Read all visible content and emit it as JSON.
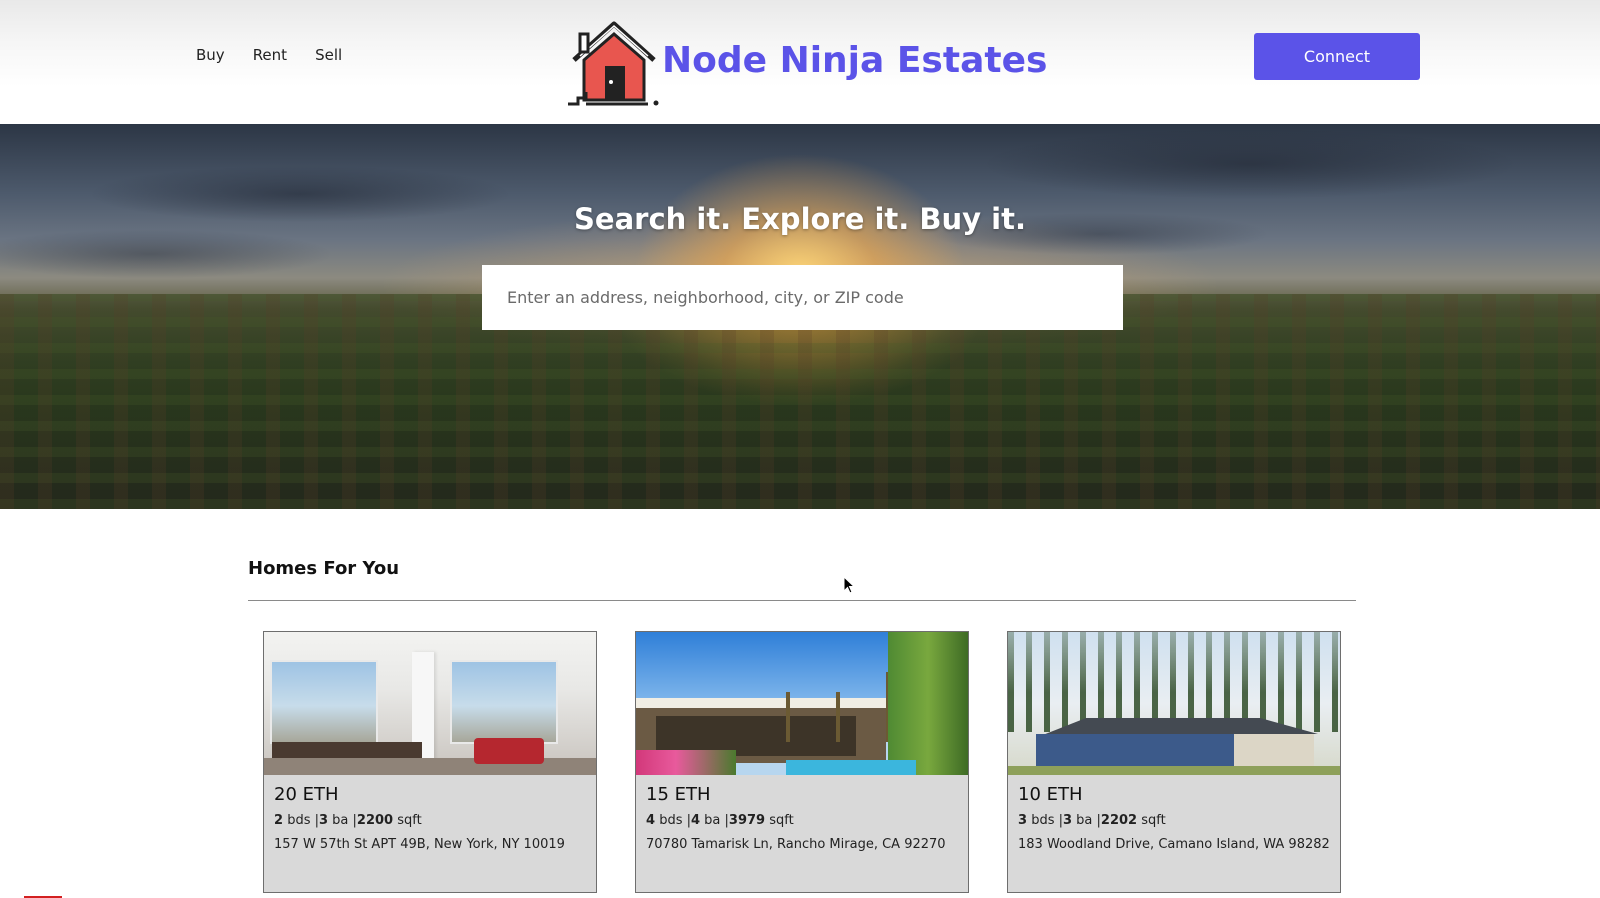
{
  "nav": {
    "buy": "Buy",
    "rent": "Rent",
    "sell": "Sell"
  },
  "brand": {
    "title": "Node Ninja Estates",
    "logo_icon": "house-icon",
    "accent": "#5b53e8"
  },
  "header": {
    "connect_label": "Connect"
  },
  "hero": {
    "tagline": "Search it. Explore it. Buy it.",
    "search_placeholder": "Enter an address, neighborhood, city, or ZIP code"
  },
  "section": {
    "title": "Homes For You"
  },
  "listings": [
    {
      "price": "20 ETH",
      "beds": "2",
      "beds_unit": "bds",
      "baths": "3",
      "baths_unit": "ba",
      "sqft": "2200",
      "sqft_unit": "sqft",
      "address": "157 W 57th St APT 49B, New York, NY 10019"
    },
    {
      "price": "15 ETH",
      "beds": "4",
      "beds_unit": "bds",
      "baths": "4",
      "baths_unit": "ba",
      "sqft": "3979",
      "sqft_unit": "sqft",
      "address": "70780 Tamarisk Ln, Rancho Mirage, CA 92270"
    },
    {
      "price": "10 ETH",
      "beds": "3",
      "beds_unit": "bds",
      "baths": "3",
      "baths_unit": "ba",
      "sqft": "2202",
      "sqft_unit": "sqft",
      "address": "183 Woodland Drive, Camano Island, WA 98282"
    }
  ]
}
